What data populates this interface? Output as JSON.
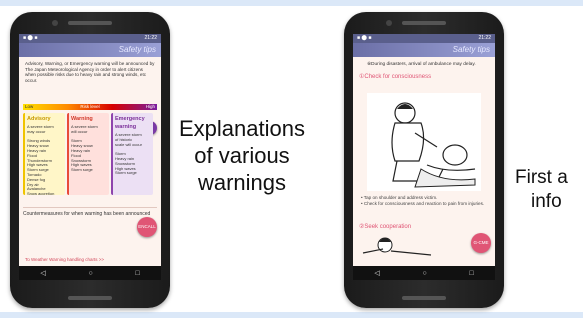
{
  "phone1": {
    "status_left": "■ ⬤ ■",
    "status_right": "21:22",
    "app_title": "Safety tips",
    "intro_text": "Advisory, Warning, or Emergency warning will be announced by The Japan Meteorological Agency in order to alert citizens when possible risks due to heavy rain and strong winds, etc occur.",
    "risk_level_label": "Risk level",
    "risk_low": "Low",
    "risk_high": "High",
    "fab_top_label": "",
    "columns": [
      {
        "heading": "Advisory",
        "lines": [
          "A severe storm",
          "may occur",
          "",
          "Strong winds",
          "Heavy snow",
          "Heavy rain",
          "Flood",
          "Thunderstorm",
          "High waves",
          "Storm surge",
          "Tornado",
          "Dense fog",
          "Dry air",
          "Avalanche",
          "Snow accretion"
        ]
      },
      {
        "heading": "Warning",
        "lines": [
          "A severe storm",
          "will occur",
          "",
          "Storm",
          "Heavy snow",
          "Heavy rain",
          "Flood",
          "Snowstorm",
          "High waves",
          "Storm surge"
        ]
      },
      {
        "heading": "Emergency warning",
        "lines": [
          "A severe storm",
          "of historic",
          "scale will occur",
          "",
          "Storm",
          "Heavy rain",
          "Snowstorm",
          "High waves",
          "Storm surge"
        ]
      }
    ],
    "countermeasures": "Countermeasures for when warning has been announced",
    "handling_link": "To Weather Warning handling charts >>",
    "fab_label": "ENCALL",
    "nav": [
      "◁",
      "○",
      "□"
    ]
  },
  "caption1": {
    "lines": [
      "Explanations",
      "of various",
      "warnings"
    ]
  },
  "phone2": {
    "status_left": "■ ⬤ ■",
    "status_right": "21:22",
    "app_title": "Safety tips",
    "note": "※During disasters, arrival of ambulance may delay.",
    "section1": "①Check for consciousness",
    "bullets": [
      "• Tap on shoulder and address victim.",
      "• Check for consciousness and reaction to pain from injuries."
    ],
    "section2": "②Seek cooperation",
    "fab_label": "G-CME",
    "nav": [
      "◁",
      "○",
      "□"
    ]
  },
  "caption2": {
    "lines": [
      "First a",
      "info"
    ]
  }
}
